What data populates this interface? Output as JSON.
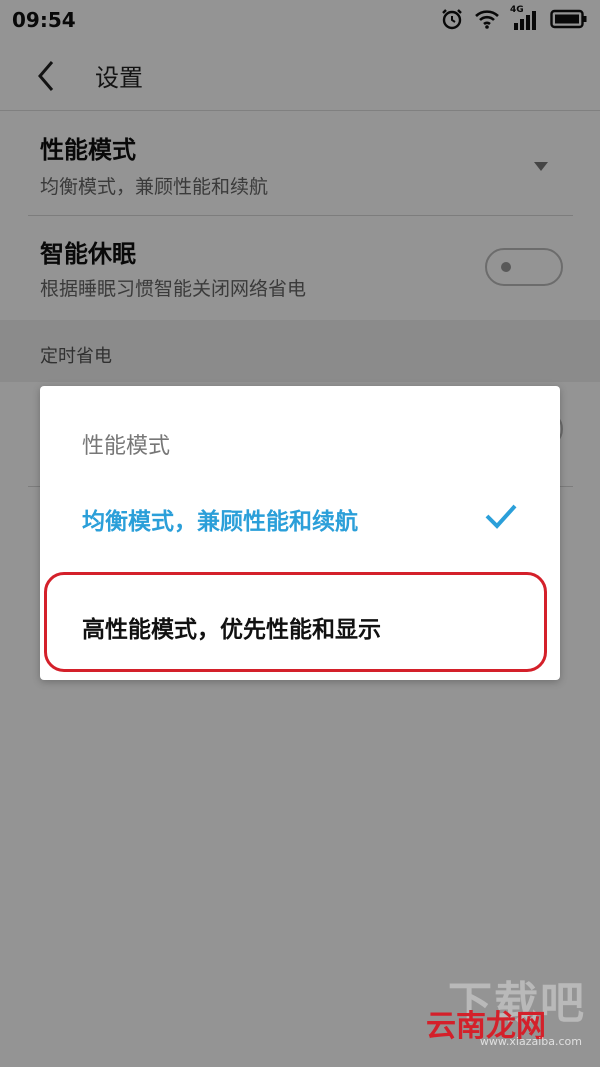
{
  "status_bar": {
    "time": "09:54",
    "network": "4G"
  },
  "header": {
    "title": "设置"
  },
  "settings": {
    "performance": {
      "title": "性能模式",
      "subtitle": "均衡模式，兼顾性能和续航"
    },
    "smart_sleep": {
      "title": "智能休眠",
      "subtitle": "根据睡眠习惯智能关闭网络省电",
      "enabled": false
    },
    "section_label": "定时省电"
  },
  "dialog": {
    "title": "性能模式",
    "options": [
      {
        "label": "均衡模式，兼顾性能和续航",
        "selected": true
      },
      {
        "label": "高性能模式，优先性能和显示",
        "selected": false
      }
    ]
  },
  "colors": {
    "accent": "#2b9fd9",
    "highlight": "#d4202a"
  },
  "watermark": {
    "brand": "下载吧",
    "site": "云南龙网",
    "url": "www.xiazaiba.com"
  }
}
